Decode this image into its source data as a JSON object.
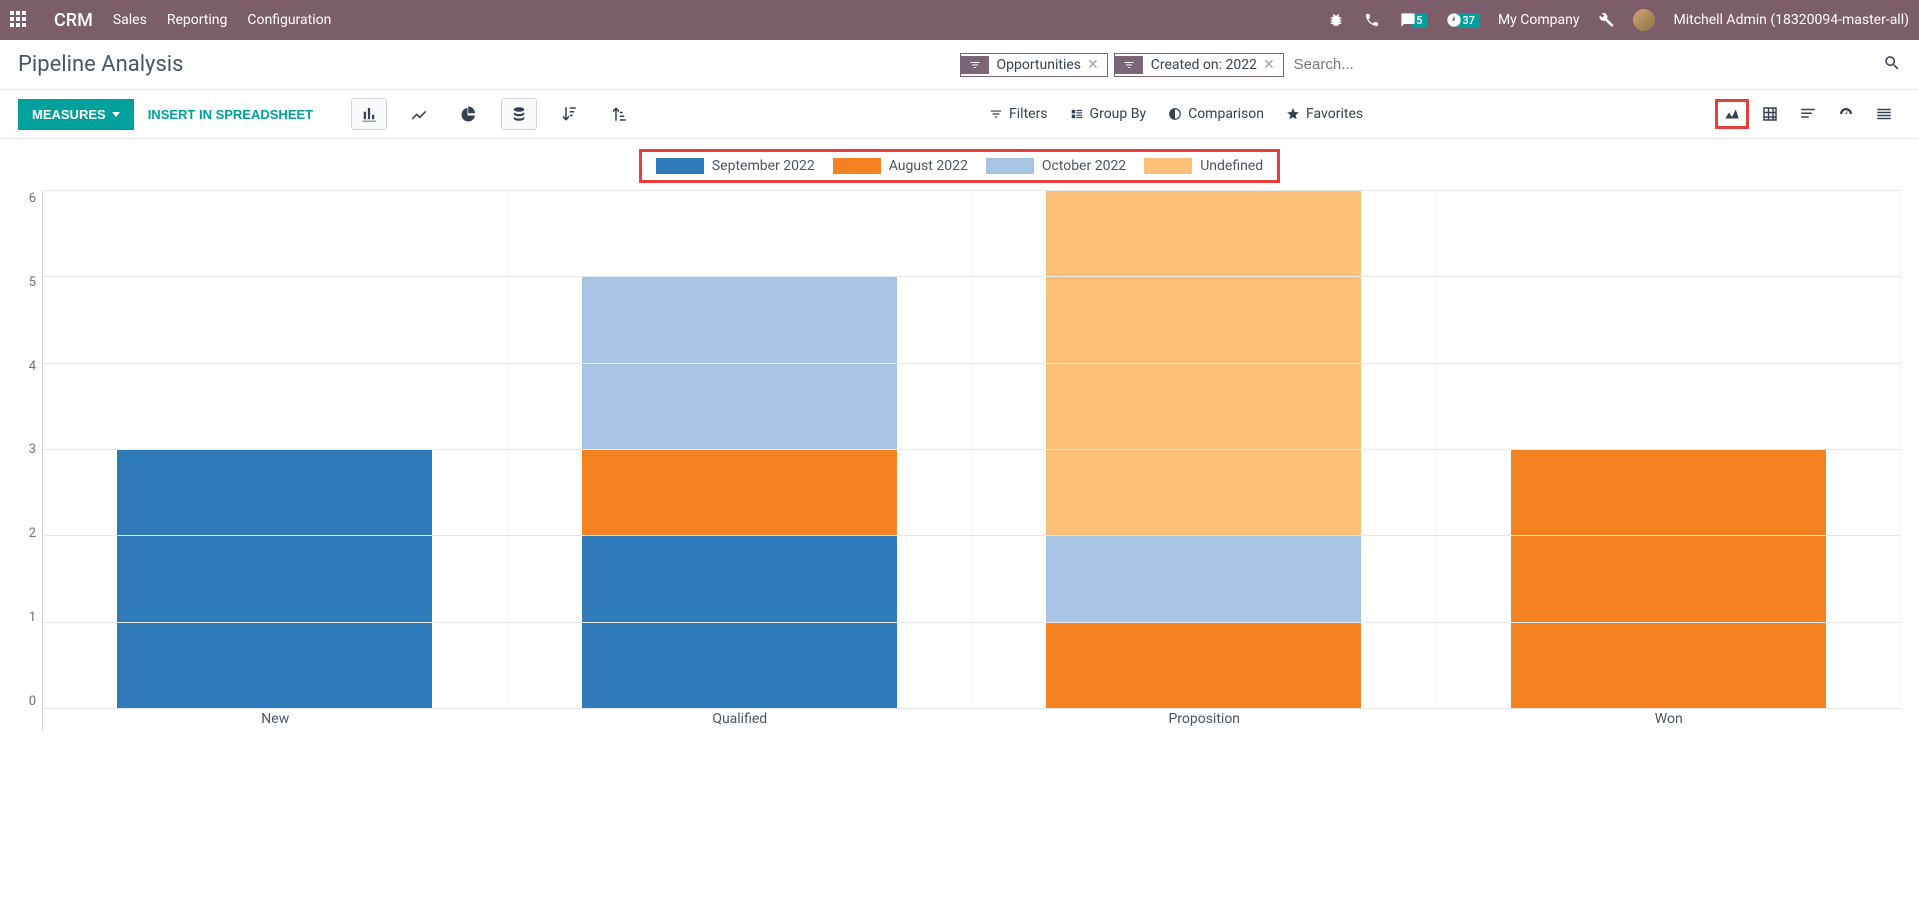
{
  "navbar": {
    "app_name": "CRM",
    "links": [
      "Sales",
      "Reporting",
      "Configuration"
    ],
    "message_count": "5",
    "clock_count": "37",
    "company": "My Company",
    "user": "Mitchell Admin (18320094-master-all)"
  },
  "header": {
    "title": "Pipeline Analysis",
    "filter1": "Opportunities",
    "filter2": "Created on: 2022",
    "search_placeholder": "Search..."
  },
  "toolbar": {
    "measures": "MEASURES",
    "insert": "INSERT IN SPREADSHEET",
    "filters": "Filters",
    "groupby": "Group By",
    "comparison": "Comparison",
    "favorites": "Favorites"
  },
  "legend": {
    "s1": "September 2022",
    "s2": "August 2022",
    "s3": "October 2022",
    "s4": "Undefined"
  },
  "colors": {
    "september": "#2f7ab8",
    "august": "#f58220",
    "october": "#a8c4e5",
    "undefined": "#fbbf77"
  },
  "chart_data": {
    "type": "bar",
    "stacked": true,
    "title": "Pipeline Analysis",
    "xlabel": "",
    "ylabel": "",
    "ylim": [
      0,
      6
    ],
    "yticks": [
      0,
      1,
      2,
      3,
      4,
      5,
      6
    ],
    "categories": [
      "New",
      "Qualified",
      "Proposition",
      "Won"
    ],
    "series": [
      {
        "name": "September 2022",
        "color": "#2f7ab8",
        "values": [
          3,
          2,
          0,
          0
        ]
      },
      {
        "name": "August 2022",
        "color": "#f58220",
        "values": [
          0,
          1,
          1,
          3
        ]
      },
      {
        "name": "October 2022",
        "color": "#a8c4e5",
        "values": [
          0,
          2,
          1,
          0
        ]
      },
      {
        "name": "Undefined",
        "color": "#fbbf77",
        "values": [
          0,
          0,
          4,
          0
        ]
      }
    ],
    "legend_position": "top",
    "grid": true
  }
}
